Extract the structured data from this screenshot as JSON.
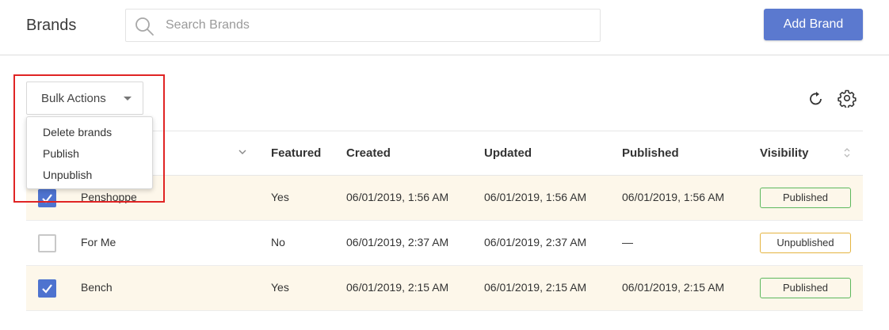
{
  "header": {
    "title": "Brands",
    "search_placeholder": "Search Brands",
    "add_button": "Add Brand"
  },
  "toolbar": {
    "bulk_actions_label": "Bulk Actions",
    "bulk_menu": [
      "Delete brands",
      "Publish",
      "Unpublish"
    ]
  },
  "table": {
    "columns": [
      "Featured",
      "Created",
      "Updated",
      "Published",
      "Visibility"
    ],
    "rows": [
      {
        "checked": true,
        "name": "Penshoppe",
        "featured": "Yes",
        "created": "06/01/2019, 1:56 AM",
        "updated": "06/01/2019, 1:56 AM",
        "published": "06/01/2019, 1:56 AM",
        "visibility": "Published"
      },
      {
        "checked": false,
        "name": "For Me",
        "featured": "No",
        "created": "06/01/2019, 2:37 AM",
        "updated": "06/01/2019, 2:37 AM",
        "published": "—",
        "visibility": "Unpublished"
      },
      {
        "checked": true,
        "name": "Bench",
        "featured": "Yes",
        "created": "06/01/2019, 2:15 AM",
        "updated": "06/01/2019, 2:15 AM",
        "published": "06/01/2019, 2:15 AM",
        "visibility": "Published"
      }
    ]
  },
  "colors": {
    "accent": "#5b79cf",
    "published_border": "#5cb85c",
    "unpublished_border": "#e5b440",
    "selected_row": "#fdf7ea",
    "annotation": "#e02424"
  }
}
